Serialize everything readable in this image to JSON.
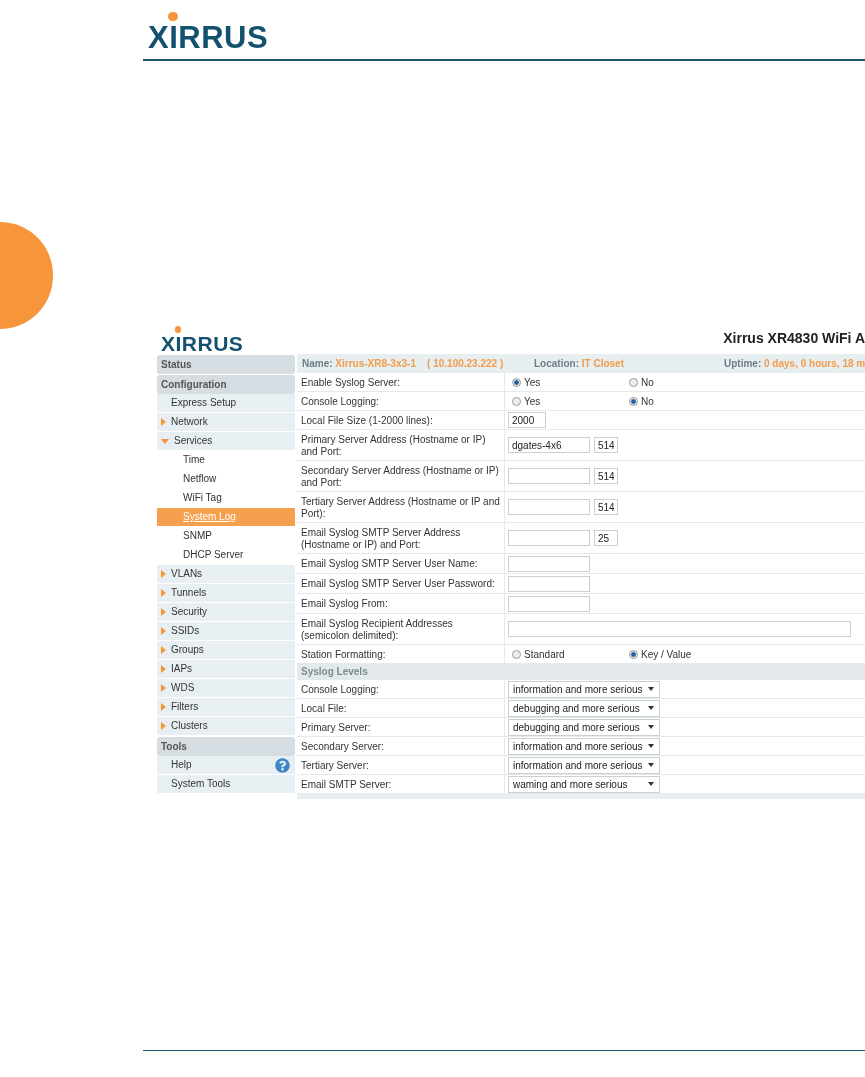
{
  "header": {
    "logo": "XIRRUS"
  },
  "screenshot": {
    "logo": "XIRRUS",
    "title": "Xirrus XR4830 WiFi A",
    "info": [
      {
        "label": "Name:",
        "value": "Xirrus-XR8-3x3-1    ( 10.100.23.222 )"
      },
      {
        "label": "Location:",
        "value": "IT Closet"
      },
      {
        "label": "Uptime:",
        "value": "0 days, 0 hours, 18 m"
      }
    ],
    "sidebar": [
      {
        "kind": "section",
        "label": "Status",
        "selected": false
      },
      {
        "kind": "section",
        "label": "Configuration",
        "selected": false
      },
      {
        "kind": "link",
        "label": "Express Setup",
        "selected": false
      },
      {
        "kind": "group",
        "label": "Network",
        "expanded": false,
        "selected": false
      },
      {
        "kind": "group",
        "label": "Services",
        "expanded": true,
        "selected": false,
        "children": [
          {
            "label": "Time",
            "selected": false
          },
          {
            "label": "Netflow",
            "selected": false
          },
          {
            "label": "WiFi Tag",
            "selected": false
          },
          {
            "label": "System Log",
            "selected": true
          },
          {
            "label": "SNMP",
            "selected": false
          },
          {
            "label": "DHCP Server",
            "selected": false
          }
        ]
      },
      {
        "kind": "group",
        "label": "VLANs",
        "expanded": false,
        "selected": false
      },
      {
        "kind": "group",
        "label": "Tunnels",
        "expanded": false,
        "selected": false
      },
      {
        "kind": "group",
        "label": "Security",
        "expanded": false,
        "selected": false
      },
      {
        "kind": "group",
        "label": "SSIDs",
        "expanded": false,
        "selected": false
      },
      {
        "kind": "group",
        "label": "Groups",
        "expanded": false,
        "selected": false
      },
      {
        "kind": "group",
        "label": "IAPs",
        "expanded": false,
        "selected": false
      },
      {
        "kind": "group",
        "label": "WDS",
        "expanded": false,
        "selected": false
      },
      {
        "kind": "group",
        "label": "Filters",
        "expanded": false,
        "selected": false
      },
      {
        "kind": "group",
        "label": "Clusters",
        "expanded": false,
        "selected": false
      },
      {
        "kind": "section",
        "label": "Tools",
        "selected": false
      },
      {
        "kind": "help",
        "label": "Help",
        "selected": false
      },
      {
        "kind": "link",
        "label": "System Tools",
        "selected": false
      }
    ],
    "rows": [
      {
        "kind": "radio",
        "label": "Enable Syslog Server:",
        "options": [
          {
            "label": "Yes",
            "selected": true
          },
          {
            "label": "No",
            "selected": false
          }
        ]
      },
      {
        "kind": "radio",
        "label": "Console Logging:",
        "options": [
          {
            "label": "Yes",
            "selected": false
          },
          {
            "label": "No",
            "selected": true
          }
        ]
      },
      {
        "kind": "text",
        "label": "Local File Size (1-2000 lines):",
        "value": "2000"
      },
      {
        "kind": "address",
        "label": "Primary Server Address (Hostname or IP) and Port:",
        "host": "dgates-4x6",
        "port": "514"
      },
      {
        "kind": "address",
        "label": "Secondary Server Address (Hostname or IP) and Port:",
        "port": "514"
      },
      {
        "kind": "address",
        "label": "Tertiary Server Address (Hostname or IP and Port):",
        "port": "514"
      },
      {
        "kind": "address",
        "label": "Email Syslog SMTP Server Address (Hostname or IP) and Port:",
        "port": "25"
      },
      {
        "kind": "field",
        "label": "Email Syslog SMTP Server User Name:"
      },
      {
        "kind": "field",
        "label": "Email Syslog SMTP Server User Password:"
      },
      {
        "kind": "field",
        "label": "Email Syslog From:"
      },
      {
        "kind": "wide",
        "label": "Email Syslog Recipient Addresses (semicolon delimited):"
      },
      {
        "kind": "radio",
        "label": "Station Formatting:",
        "options": [
          {
            "label": "Standard",
            "selected": false
          },
          {
            "label": "Key / Value",
            "selected": true
          }
        ]
      },
      {
        "kind": "heading",
        "label": "Syslog Levels"
      },
      {
        "kind": "select",
        "label": "Console Logging:",
        "value": "information and more serious"
      },
      {
        "kind": "select",
        "label": "Local File:",
        "value": "debugging and more serious"
      },
      {
        "kind": "select",
        "label": "Primary Server:",
        "value": "debugging and more serious"
      },
      {
        "kind": "select",
        "label": "Secondary Server:",
        "value": "information and more serious"
      },
      {
        "kind": "select",
        "label": "Tertiary Server:",
        "value": "information and more serious"
      },
      {
        "kind": "select",
        "label": "Email SMTP Server:",
        "value": "waming and more serious"
      }
    ]
  }
}
